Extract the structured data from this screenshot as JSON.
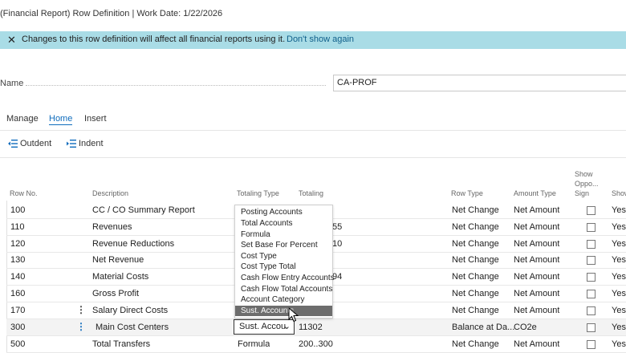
{
  "window": {
    "title": "(Financial Report) Row Definition | Work Date: 1/22/2026"
  },
  "banner": {
    "message": "Changes to this row definition will affect all financial reports using it.",
    "link": "Don't show again"
  },
  "name_field": {
    "label": "Name",
    "value": "CA-PROF"
  },
  "tabs": [
    {
      "label": "Manage"
    },
    {
      "label": "Home"
    },
    {
      "label": "Insert"
    }
  ],
  "actions": {
    "outdent": "Outdent",
    "indent": "Indent"
  },
  "columns": {
    "row_no": "Row No.",
    "description": "Description",
    "totaling_type": "Totaling Type",
    "totaling": "Totaling",
    "row_type": "Row Type",
    "amount_type": "Amount Type",
    "show_opp_1": "Show",
    "show_opp_2": "Oppo...",
    "show_opp_3": "Sign",
    "show": "Show"
  },
  "rows": [
    {
      "no": "100",
      "desc": "CC / CO Summary Report",
      "ttype": "",
      "tot": "",
      "rtype": "Net Change",
      "atype": "Net Amount",
      "show": "Yes"
    },
    {
      "no": "110",
      "desc": "Revenues",
      "ttype": "",
      "tot": "55",
      "rtype": "Net Change",
      "atype": "Net Amount",
      "show": "Yes"
    },
    {
      "no": "120",
      "desc": "Revenue Reductions",
      "ttype": "",
      "tot": "10",
      "rtype": "Net Change",
      "atype": "Net Amount",
      "show": "Yes"
    },
    {
      "no": "130",
      "desc": "Net Revenue",
      "ttype": "",
      "tot": "",
      "rtype": "Net Change",
      "atype": "Net Amount",
      "show": "Yes"
    },
    {
      "no": "140",
      "desc": "Material Costs",
      "ttype": "",
      "tot": "94",
      "rtype": "Net Change",
      "atype": "Net Amount",
      "show": "Yes"
    },
    {
      "no": "160",
      "desc": "Gross Profit",
      "ttype": "",
      "tot": "",
      "rtype": "Net Change",
      "atype": "Net Amount",
      "show": "Yes"
    },
    {
      "no": "170",
      "desc": "Salary Direct Costs",
      "ttype": "",
      "tot": "",
      "rtype": "Net Change",
      "atype": "Net Amount",
      "show": "Yes"
    },
    {
      "no": "300",
      "desc": "Main Cost Centers",
      "ttype": "Sust. Accou",
      "tot": "11302",
      "rtype": "Balance at Da...",
      "atype": "CO2e",
      "show": "Yes"
    },
    {
      "no": "500",
      "desc": "Total Transfers",
      "ttype": "Formula",
      "tot": "200..300",
      "rtype": "Net Change",
      "atype": "Net Amount",
      "show": "Yes"
    }
  ],
  "dropdown": {
    "options": [
      "Posting Accounts",
      "Total Accounts",
      "Formula",
      "Set Base For Percent",
      "Cost Type",
      "Cost Type Total",
      "Cash Flow Entry Accounts",
      "Cash Flow Total Accounts",
      "Account Category",
      "Sust. Accounts"
    ],
    "highlighted": "Sust. Accounts"
  },
  "colors": {
    "banner_bg": "#a9dce6",
    "link": "#0f5f8a",
    "accent": "#0f6cbd",
    "highlight": "#6d6d6d"
  }
}
